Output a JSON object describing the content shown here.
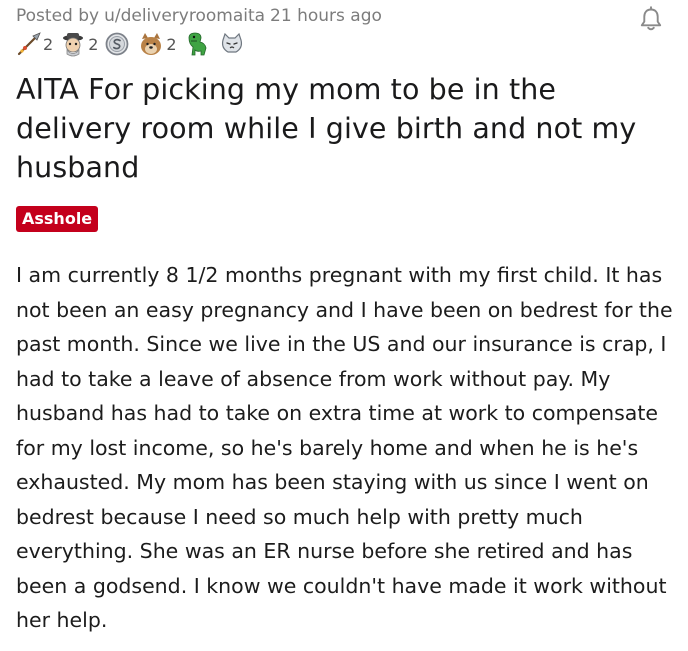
{
  "post": {
    "posted_by_prefix": "Posted by",
    "author": "u/deliveryroomaita",
    "time_ago": "21 hours ago",
    "awards": [
      {
        "icon": "spear-award-icon",
        "count": "2"
      },
      {
        "icon": "detective-award-icon",
        "count": "2"
      },
      {
        "icon": "silver-coin-award-icon",
        "count": ""
      },
      {
        "icon": "doge-award-icon",
        "count": "2"
      },
      {
        "icon": "dinosaur-award-icon",
        "count": ""
      },
      {
        "icon": "cat-award-icon",
        "count": ""
      }
    ],
    "title": "AITA For picking my mom to be in the delivery room while I give birth and not my husband",
    "flair": "Asshole",
    "body": "I am currently 8 1/2 months pregnant with my first child. It has not been an easy pregnancy and I have been on bedrest for the past month. Since we live in the US and our insurance is crap, I had to take a leave of absence from work without pay. My husband has had to take on extra time at work to compensate for my lost income, so he's barely home and when he is he's exhausted. My mom has been staying with us since I went on bedrest because I need so much help with pretty much everything. She was an ER nurse before she retired and has been a godsend. I know we couldn't have made it work without her help."
  },
  "colors": {
    "flair_bg": "#c4001c",
    "meta_text": "#7c7c7c",
    "title_text": "#1a1a1b"
  },
  "icons": {
    "notification": "bell-icon"
  }
}
